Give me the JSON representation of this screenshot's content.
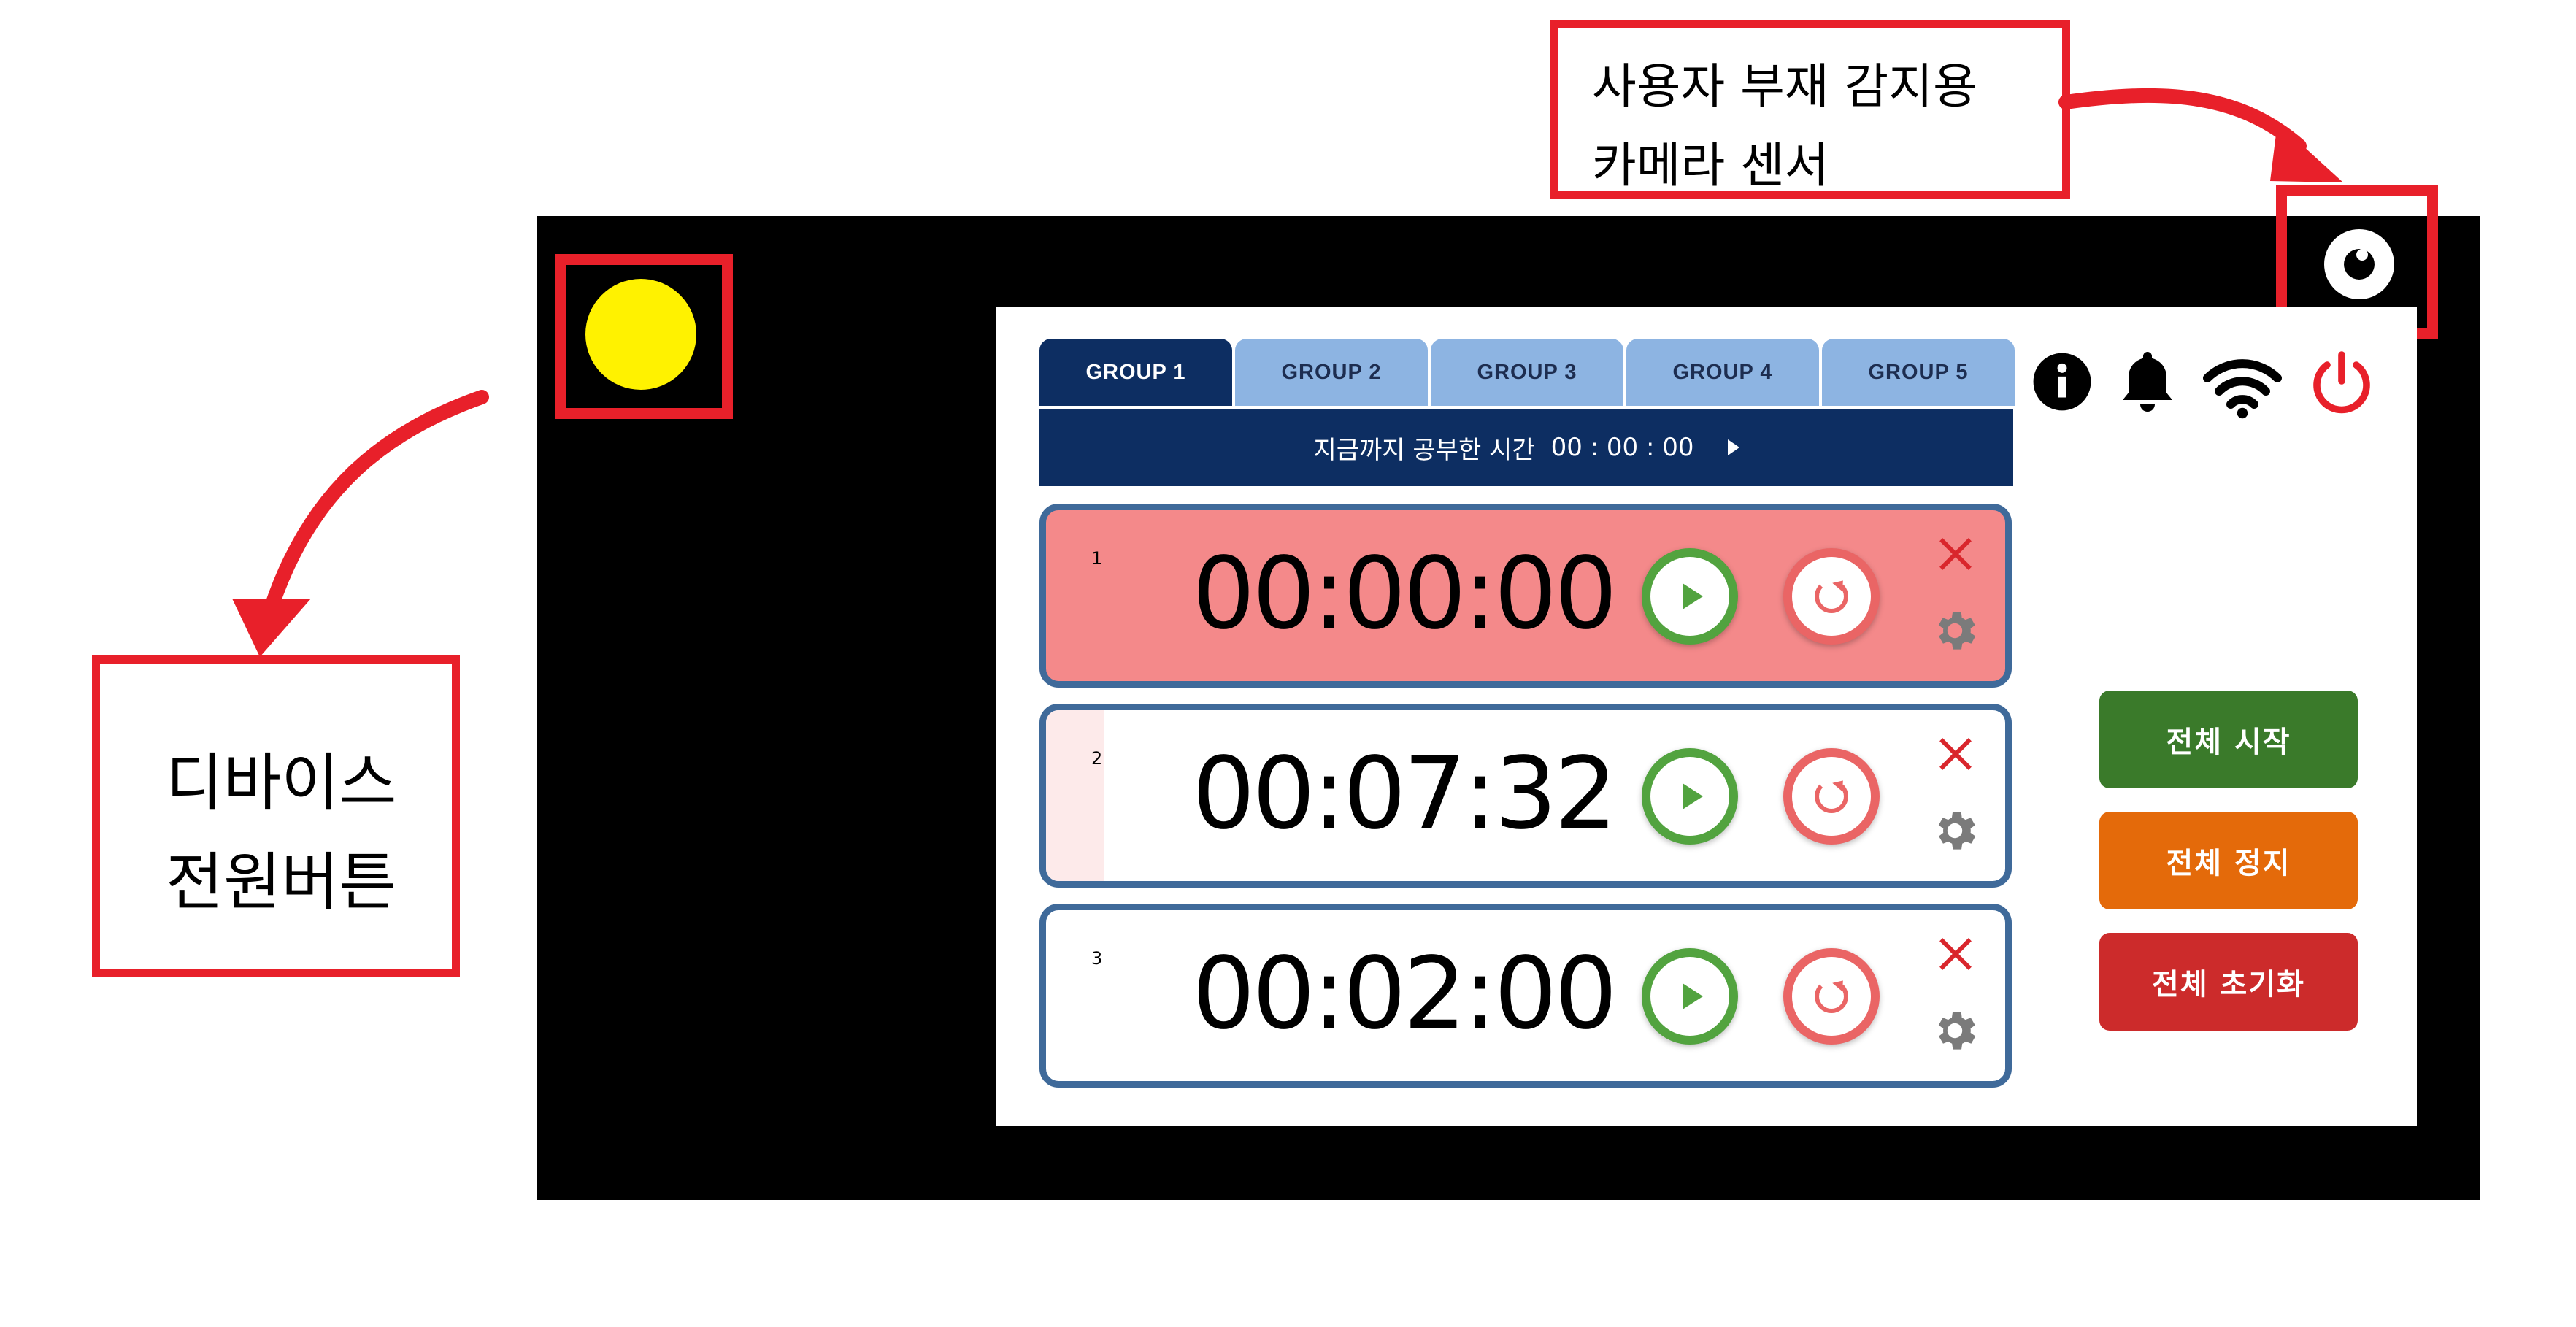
{
  "annotations": {
    "camera": {
      "line1": "사용자 부재 감지용",
      "line2": "카메라 센서"
    },
    "power": {
      "line1": "디바이스",
      "line2": "전원버튼"
    },
    "highlight_color": "#e8202a"
  },
  "tabs": [
    {
      "label": "GROUP 1",
      "active": true
    },
    {
      "label": "GROUP 2",
      "active": false
    },
    {
      "label": "GROUP 3",
      "active": false
    },
    {
      "label": "GROUP 4",
      "active": false
    },
    {
      "label": "GROUP 5",
      "active": false
    }
  ],
  "study_time": {
    "label": "지금까지 공부한 시간",
    "value": "00 : 00 : 00"
  },
  "timers": [
    {
      "index": "1",
      "time": "00:00:00",
      "state": "alert"
    },
    {
      "index": "2",
      "time": "00:07:32",
      "state": "normal"
    },
    {
      "index": "3",
      "time": "00:02:00",
      "state": "normal"
    }
  ],
  "status_icons": [
    "info-icon",
    "bell-icon",
    "wifi-icon",
    "power-icon"
  ],
  "actions": {
    "start_all": "전체 시작",
    "stop_all": "전체 정지",
    "reset_all": "전체 초기화"
  },
  "colors": {
    "tab_active": "#0d2e62",
    "tab_inactive": "#8db4e2",
    "start": "#3a7a2a",
    "stop": "#e46a0a",
    "reset": "#cc2b2b",
    "alert_card": "#f4898a",
    "power_button": "#fff200"
  }
}
